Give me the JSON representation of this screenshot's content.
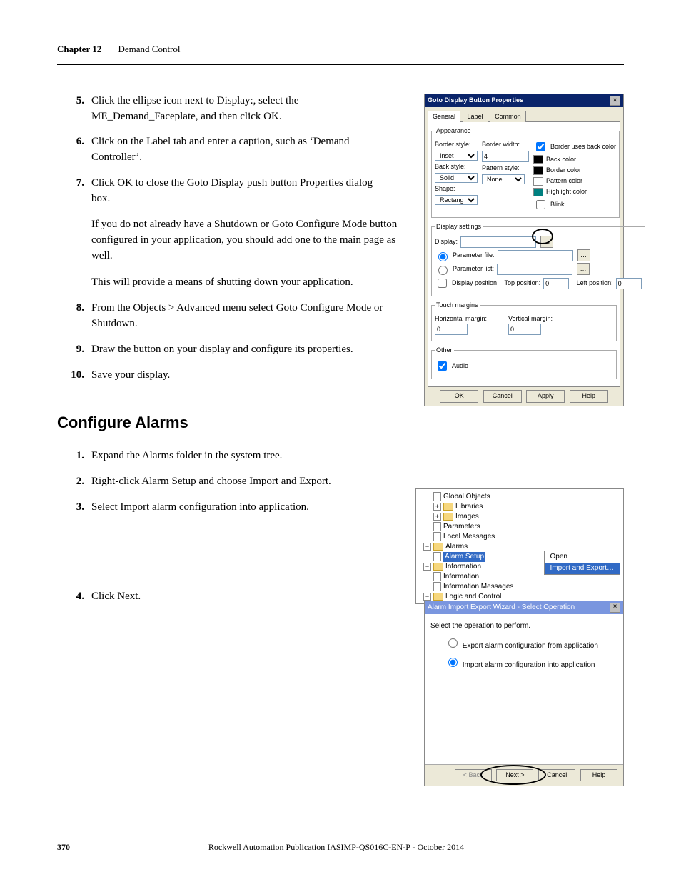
{
  "header": {
    "chapter": "Chapter 12",
    "title": "Demand Control"
  },
  "steps_a": [
    {
      "n": "5.",
      "t": "Click the ellipse icon next to Display:, select the ME_Demand_Faceplate, and then click OK."
    },
    {
      "n": "6.",
      "t": "Click on the Label tab and enter a caption, such as ‘Demand Controller’."
    },
    {
      "n": "7.",
      "t": "Click OK to close the Goto Display push button Properties dialog box."
    }
  ],
  "notes_a": [
    "If you do not already have a Shutdown or Goto Configure Mode button configured in your application, you should add one to the main page as well.",
    "This will provide a means of shutting down your application."
  ],
  "steps_b": [
    {
      "n": "8.",
      "t": "From the Objects > Advanced menu select Goto Configure Mode or Shutdown."
    },
    {
      "n": "9.",
      "t": "Draw the button on your display and configure its properties."
    },
    {
      "n": "10.",
      "t": "Save your display."
    }
  ],
  "section": "Configure Alarms",
  "steps_c": [
    {
      "n": "1.",
      "t": "Expand the Alarms folder in the system tree."
    },
    {
      "n": "2.",
      "t": "Right-click Alarm Setup and choose Import and Export."
    },
    {
      "n": "3.",
      "t": "Select Import alarm configuration into application."
    }
  ],
  "steps_d": [
    {
      "n": "4.",
      "t": "Click Next."
    }
  ],
  "footer": {
    "page": "370",
    "pub": "Rockwell Automation Publication IASIMP-QS016C-EN-P - October 2014"
  },
  "dlg1": {
    "title": "Goto Display Button Properties",
    "tabs": [
      "General",
      "Label",
      "Common"
    ],
    "groups": {
      "appearance": "Appearance",
      "display": "Display settings",
      "touch": "Touch margins",
      "other": "Other"
    },
    "lbl": {
      "borderstyle": "Border style:",
      "borderwidth": "Border width:",
      "backstyle": "Back style:",
      "patternstyle": "Pattern style:",
      "shape": "Shape:",
      "borderuses": "Border uses back color",
      "backcolor": "Back color",
      "bordercolor": "Border color",
      "patterncolor": "Pattern color",
      "highlightcolor": "Highlight color",
      "blink": "Blink",
      "displaylbl": "Display:",
      "paramfile": "Parameter file:",
      "paramlist": "Parameter list:",
      "disppos": "Display position",
      "toppos": "Top position:",
      "leftpos": "Left position:",
      "hmargin": "Horizontal margin:",
      "vmargin": "Vertical margin:",
      "audio": "Audio"
    },
    "val": {
      "borderstyle": "Inset",
      "borderwidth": "4",
      "backstyle": "Solid",
      "patternstyle": "None",
      "shape": "Rectangle",
      "toppos": "0",
      "leftpos": "0",
      "hmargin": "0",
      "vmargin": "0"
    },
    "btn": {
      "ok": "OK",
      "cancel": "Cancel",
      "apply": "Apply",
      "help": "Help"
    }
  },
  "tree": {
    "items": [
      "Global Objects",
      "Libraries",
      "Images",
      "Parameters",
      "Local Messages",
      "Alarms",
      "Alarm Setup",
      "Information",
      "Information",
      "Information Messages",
      "Logic and Control"
    ],
    "menu": {
      "open": "Open",
      "importexport": "Import and Export…"
    }
  },
  "wizard": {
    "title": "Alarm Import Export Wizard - Select Operation",
    "prompt": "Select the operation to perform.",
    "opt1": "Export alarm configuration from application",
    "opt2": "Import alarm configuration into application",
    "btn": {
      "back": "< Back",
      "next": "Next >",
      "cancel": "Cancel",
      "help": "Help"
    }
  }
}
